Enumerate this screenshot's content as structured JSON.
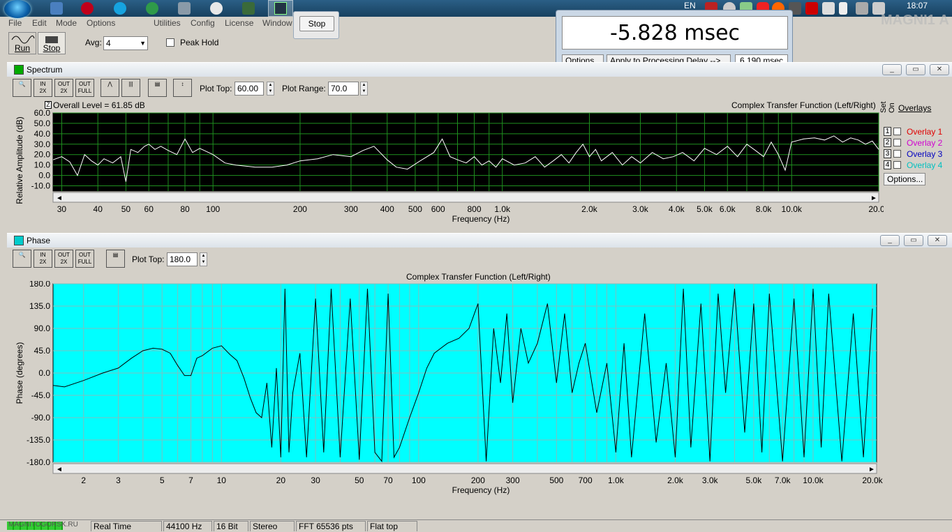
{
  "taskbar": {
    "language": "EN",
    "clock": "18:07"
  },
  "menu": [
    "File",
    "Edit",
    "Mode",
    "Options",
    "Utilities",
    "Config",
    "License",
    "Window"
  ],
  "stop_popup": {
    "label": "Stop"
  },
  "delay": {
    "readout": "-5.828 msec",
    "options_label": "Options...",
    "apply_label": "Apply to Processing Delay -->",
    "value": "6.190 msec"
  },
  "toolbar": {
    "run_label": "Run",
    "stop_label": "Stop",
    "avg_label": "Avg:",
    "avg_value": "4",
    "peak_hold_label": "Peak Hold"
  },
  "spectrum": {
    "title": "Spectrum",
    "plot_top_label": "Plot Top:",
    "plot_top_value": "60.00",
    "plot_range_label": "Plot Range:",
    "plot_range_value": "70.0",
    "overall_level": "Overall Level = 61.85 dB",
    "chart_title": "Complex Transfer Function (Left/Right)",
    "ylabel": "Relative Amplitude (dB)",
    "xlabel": "Frequency (Hz)",
    "overlays_label": "Overlays",
    "set_label": "Set",
    "on_label": "On",
    "overlay_items": [
      {
        "num": "1",
        "name": "Overlay 1",
        "color": "#e00000"
      },
      {
        "num": "2",
        "name": "Overlay 2",
        "color": "#d000d0"
      },
      {
        "num": "3",
        "name": "Overlay 3",
        "color": "#0000c0"
      },
      {
        "num": "4",
        "name": "Overlay 4",
        "color": "#00c0c0"
      }
    ],
    "options_label": "Options..."
  },
  "phase": {
    "title": "Phase",
    "plot_top_label": "Plot Top:",
    "plot_top_value": "180.0",
    "chart_title": "Complex Transfer Function (Left/Right)",
    "ylabel": "Phase (degrees)",
    "xlabel": "Frequency (Hz)"
  },
  "chart_data": [
    {
      "type": "line",
      "title": "Complex Transfer Function (Left/Right)",
      "xlabel": "Frequency (Hz)",
      "ylabel": "Relative Amplitude (dB)",
      "x_scale": "log",
      "xlim": [
        28,
        20000
      ],
      "ylim": [
        -15,
        60
      ],
      "yticks": [
        "60.0",
        "50.0",
        "40.0",
        "30.0",
        "20.0",
        "10.0",
        "0.0",
        "-10.0"
      ],
      "xticks": [
        {
          "v": 30,
          "t": "30"
        },
        {
          "v": 40,
          "t": "40"
        },
        {
          "v": 50,
          "t": "50"
        },
        {
          "v": 60,
          "t": "60"
        },
        {
          "v": 80,
          "t": "80"
        },
        {
          "v": 100,
          "t": "100"
        },
        {
          "v": 200,
          "t": "200"
        },
        {
          "v": 300,
          "t": "300"
        },
        {
          "v": 400,
          "t": "400"
        },
        {
          "v": 500,
          "t": "500"
        },
        {
          "v": 600,
          "t": "600"
        },
        {
          "v": 800,
          "t": "800"
        },
        {
          "v": 1000,
          "t": "1.0k"
        },
        {
          "v": 2000,
          "t": "2.0k"
        },
        {
          "v": 3000,
          "t": "3.0k"
        },
        {
          "v": 4000,
          "t": "4.0k"
        },
        {
          "v": 5000,
          "t": "5.0k"
        },
        {
          "v": 6000,
          "t": "6.0k"
        },
        {
          "v": 8000,
          "t": "8.0k"
        },
        {
          "v": 10000,
          "t": "10.0k"
        },
        {
          "v": 20000,
          "t": "20.0k"
        }
      ],
      "grid": true,
      "background": "#000000",
      "grid_color": "#1f8f1f",
      "line_color": "#ffffff",
      "x": [
        28,
        30,
        32,
        34,
        36,
        38,
        40,
        42,
        45,
        48,
        50,
        52,
        55,
        58,
        60,
        63,
        66,
        70,
        75,
        80,
        85,
        90,
        100,
        110,
        120,
        140,
        160,
        180,
        200,
        230,
        260,
        300,
        330,
        360,
        400,
        430,
        470,
        520,
        580,
        620,
        660,
        700,
        750,
        800,
        850,
        900,
        950,
        1000,
        1100,
        1200,
        1300,
        1400,
        1500,
        1600,
        1700,
        1800,
        1900,
        2000,
        2100,
        2200,
        2400,
        2600,
        2800,
        3000,
        3300,
        3600,
        3900,
        4200,
        4600,
        5000,
        5500,
        6000,
        6500,
        7000,
        7500,
        8000,
        8500,
        9000,
        9500,
        10000,
        11000,
        12000,
        13000,
        14000,
        15000,
        16000,
        17000,
        18000,
        19000,
        20000
      ],
      "y": [
        15,
        18,
        13,
        0,
        20,
        14,
        10,
        16,
        12,
        18,
        -6,
        25,
        22,
        28,
        30,
        25,
        28,
        24,
        20,
        35,
        22,
        26,
        20,
        12,
        10,
        8,
        8,
        10,
        14,
        16,
        20,
        18,
        24,
        28,
        15,
        8,
        6,
        14,
        22,
        35,
        18,
        15,
        12,
        18,
        10,
        14,
        8,
        16,
        10,
        12,
        18,
        8,
        14,
        20,
        12,
        22,
        30,
        18,
        25,
        14,
        22,
        10,
        18,
        12,
        22,
        16,
        18,
        22,
        14,
        26,
        20,
        28,
        18,
        30,
        24,
        18,
        32,
        20,
        5,
        32,
        35,
        36,
        34,
        38,
        32,
        36,
        34,
        30,
        33,
        25
      ]
    },
    {
      "type": "line",
      "title": "Complex Transfer Function (Left/Right)",
      "xlabel": "Frequency (Hz)",
      "ylabel": "Phase (degrees)",
      "x_scale": "log",
      "xlim": [
        1.4,
        21000
      ],
      "ylim": [
        -180,
        180
      ],
      "yticks": [
        "180.0",
        "135.0",
        "90.0",
        "45.0",
        "0.0",
        "-45.0",
        "-90.0",
        "-135.0",
        "-180.0"
      ],
      "xticks": [
        {
          "v": 2,
          "t": "2"
        },
        {
          "v": 3,
          "t": "3"
        },
        {
          "v": 5,
          "t": "5"
        },
        {
          "v": 7,
          "t": "7"
        },
        {
          "v": 10,
          "t": "10"
        },
        {
          "v": 20,
          "t": "20"
        },
        {
          "v": 30,
          "t": "30"
        },
        {
          "v": 50,
          "t": "50"
        },
        {
          "v": 70,
          "t": "70"
        },
        {
          "v": 100,
          "t": "100"
        },
        {
          "v": 200,
          "t": "200"
        },
        {
          "v": 300,
          "t": "300"
        },
        {
          "v": 500,
          "t": "500"
        },
        {
          "v": 700,
          "t": "700"
        },
        {
          "v": 1000,
          "t": "1.0k"
        },
        {
          "v": 2000,
          "t": "2.0k"
        },
        {
          "v": 3000,
          "t": "3.0k"
        },
        {
          "v": 5000,
          "t": "5.0k"
        },
        {
          "v": 7000,
          "t": "7.0k"
        },
        {
          "v": 10000,
          "t": "10.0k"
        },
        {
          "v": 20000,
          "t": "20.0k"
        }
      ],
      "grid": true,
      "background": "#00ffff",
      "grid_color": "#7fbfbf",
      "line_color": "#000000",
      "x": [
        1.4,
        1.6,
        2,
        2.5,
        3,
        3.5,
        4,
        4.5,
        5,
        5.5,
        6,
        6.5,
        7,
        7.5,
        8,
        9,
        10,
        11,
        12,
        13,
        14,
        15,
        16,
        17,
        18,
        19,
        20,
        21,
        22,
        23,
        25,
        27,
        30,
        33,
        36,
        40,
        45,
        50,
        55,
        60,
        65,
        70,
        75,
        80,
        90,
        100,
        110,
        120,
        140,
        160,
        180,
        200,
        220,
        240,
        260,
        280,
        300,
        330,
        360,
        400,
        450,
        500,
        550,
        600,
        650,
        700,
        800,
        900,
        1000,
        1100,
        1200,
        1400,
        1600,
        1800,
        2000,
        2200,
        2400,
        2700,
        3000,
        3300,
        3600,
        4000,
        4500,
        5000,
        5500,
        6000,
        7000,
        8000,
        9000,
        10000,
        11000,
        12000,
        14000,
        16000,
        18000,
        20000
      ],
      "y": [
        -25,
        -28,
        -15,
        0,
        10,
        30,
        45,
        50,
        48,
        40,
        15,
        -5,
        -5,
        30,
        35,
        50,
        55,
        38,
        25,
        -10,
        -50,
        -80,
        -90,
        -20,
        -150,
        10,
        -170,
        170,
        -160,
        -40,
        40,
        -170,
        150,
        -160,
        170,
        -170,
        150,
        -175,
        170,
        -160,
        -178,
        160,
        -170,
        -150,
        -90,
        -40,
        10,
        40,
        60,
        70,
        90,
        140,
        -178,
        90,
        -20,
        120,
        -60,
        90,
        20,
        60,
        140,
        -20,
        120,
        -40,
        20,
        60,
        -80,
        20,
        -160,
        60,
        -170,
        120,
        -140,
        20,
        -170,
        170,
        -150,
        140,
        -178,
        160,
        -40,
        170,
        -120,
        140,
        -160,
        160,
        -178,
        150,
        -170,
        170,
        -150,
        160,
        -178,
        120,
        -170,
        130
      ]
    }
  ],
  "status": {
    "brand": "MAGNITOGORSK.RU",
    "mode": "Real Time",
    "rate": "44100 Hz",
    "bits": "16 Bit",
    "channels": "Stereo",
    "fft": "FFT 65536 pts",
    "window": "Flat top"
  }
}
